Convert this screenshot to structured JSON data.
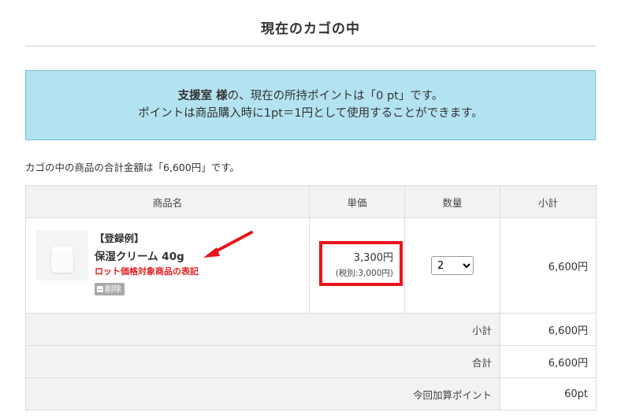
{
  "header": {
    "title": "現在のカゴの中"
  },
  "point_notice": {
    "user_name": "支援室 様",
    "line1_suffix": "の、現在の所持ポイントは「0 pt」です。",
    "line2": "ポイントは商品購入時に1pt＝1円として使用することができます。"
  },
  "cart_total_text": "カゴの中の商品の合計金額は「6,600円」です。",
  "table": {
    "headers": {
      "name": "商品名",
      "price": "単価",
      "quantity": "数量",
      "subtotal": "小計"
    },
    "items": [
      {
        "tag": "【登録例】",
        "name": "保湿クリーム 40g",
        "note": "ロット価格対象商品の表記",
        "delete_label": "削除",
        "price": "3,300円",
        "price_tax": "(税別:3,000円)",
        "quantity": "2",
        "subtotal": "6,600円"
      }
    ],
    "summary": [
      {
        "label": "小計",
        "value": "6,600円"
      },
      {
        "label": "合計",
        "value": "6,600円"
      },
      {
        "label": "今回加算ポイント",
        "value": "60pt"
      }
    ]
  },
  "colors": {
    "notice_background": "#b3e2f0",
    "notice_border": "#6fc4d8",
    "annotation_red": "#e8141b",
    "note_red": "#e31d1d"
  }
}
